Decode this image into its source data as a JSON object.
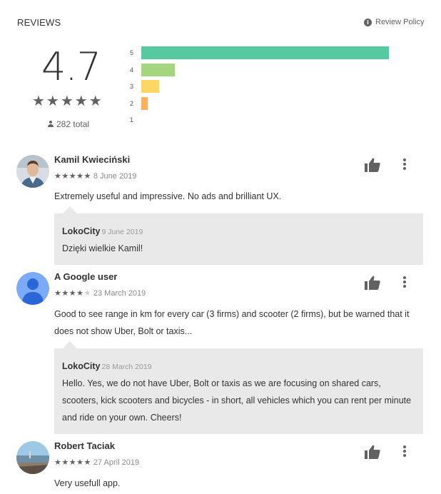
{
  "header": {
    "title": "REVIEWS",
    "policy_icon": "info-icon",
    "policy_label": "Review Policy"
  },
  "summary": {
    "score": "4.7",
    "stars": "★★★★★",
    "total_icon": "person-icon",
    "total": "282 total"
  },
  "histogram": [
    {
      "label": "5",
      "fraction": 0.63,
      "color": "#57c9a1"
    },
    {
      "label": "4",
      "fraction": 0.085,
      "color": "#a5d67f"
    },
    {
      "label": "3",
      "fraction": 0.045,
      "color": "#fdd663"
    },
    {
      "label": "2",
      "fraction": 0.017,
      "color": "#fcb162"
    },
    {
      "label": "1",
      "fraction": 0,
      "color": "#f78a71"
    }
  ],
  "reviews": [
    {
      "name": "Kamil Kwieciński",
      "rating": 5,
      "date": "8 June 2019",
      "text": "Extremely useful and impressive. No ads and brilliant UX.",
      "avatar": "photo-avatar",
      "reply": {
        "name": "LokoCity",
        "date": "9 June 2019",
        "text": "Dzięki wielkie Kamil!"
      }
    },
    {
      "name": "A Google user",
      "rating": 4,
      "date": "23 March 2019",
      "text": "Good to see range in km for every car (3 firms) and scooter (2 firms), but be warned that it does not show Uber, Bolt or taxis...",
      "avatar": "default-user-avatar",
      "reply": {
        "name": "LokoCity",
        "date": "28 March 2019",
        "text": "Hello. Yes, we do not have Uber, Bolt or taxis as we are focusing on shared cars, scooters, kick scooters and bicycles - in short, all vehicles which you can rent per minute and ride on your own. Cheers!"
      }
    },
    {
      "name": "Robert Taciak",
      "rating": 5,
      "date": "27 April 2019",
      "text": "Very usefull app.",
      "avatar": "landscape-photo-avatar"
    }
  ],
  "icons": {
    "thumb": "thumbs-up-icon",
    "more": "more-vert-icon"
  }
}
